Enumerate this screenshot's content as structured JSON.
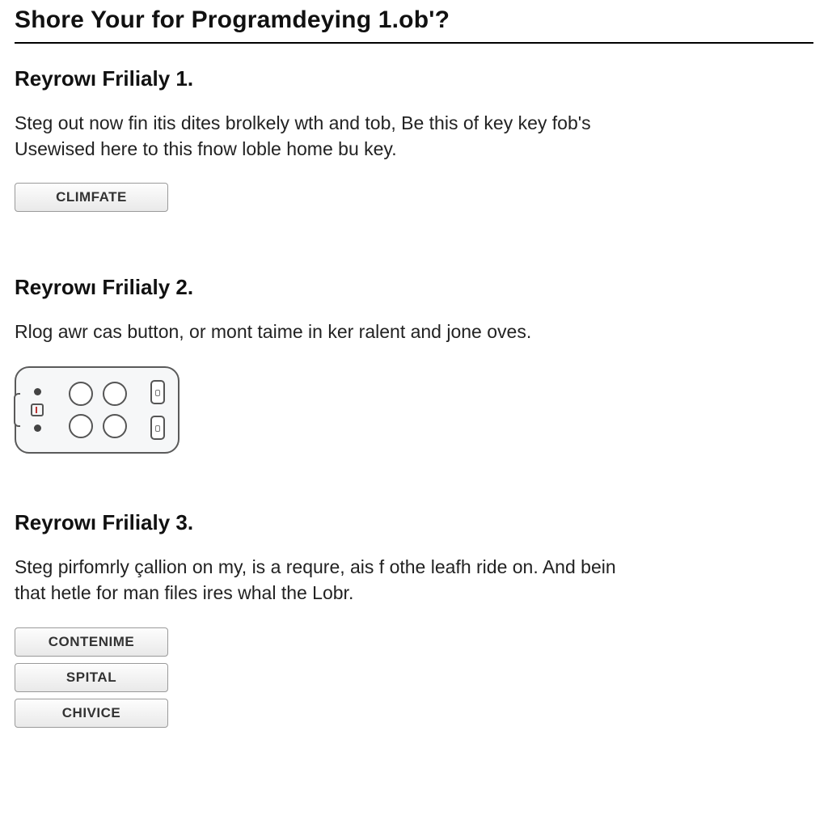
{
  "page": {
    "title": "Shore Your for Programdeying 1.ob'?"
  },
  "sections": [
    {
      "heading": "Reyrowı Frilialy 1.",
      "body": "Steg out now fin itis dites brolkely wth and tob,  Be this of key key fob's Usewised here to this fnow loble home bu key.",
      "buttons": [
        "CLIMFATE"
      ],
      "illustration": null
    },
    {
      "heading": "Reyrowı Frilialy 2.",
      "body": "Rlog awr cas button, or mont taime in ker ralent and jone oves.",
      "buttons": [],
      "illustration": "key-fob"
    },
    {
      "heading": "Reyrowı Frilialy 3.",
      "body": "Steg pirfomrly çallion on my, is a requre, ais f othe leafh ride on. And bein that hetle for man files ires whal the Lobr.",
      "buttons": [
        "CONTENIME",
        "SPITAL",
        "CHIVICE"
      ],
      "illustration": null
    }
  ]
}
